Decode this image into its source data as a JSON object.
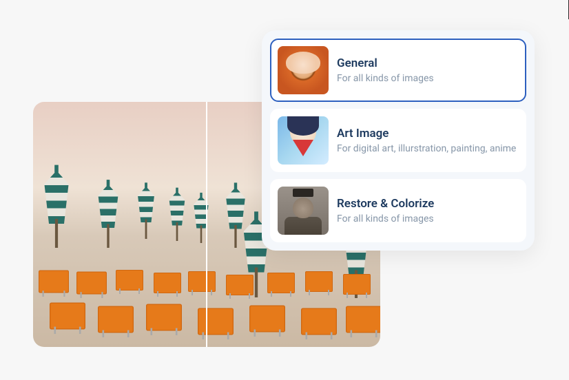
{
  "preview": {
    "alt": "beach-umbrellas-comparison"
  },
  "modes": [
    {
      "id": "general",
      "title": "General",
      "description": "For all kinds of images",
      "selected": true,
      "thumb_icon": "portrait-woman-icon"
    },
    {
      "id": "art-image",
      "title": "Art Image",
      "description": "For digital art, illurstration, painting, anime",
      "selected": false,
      "thumb_icon": "anime-girl-icon"
    },
    {
      "id": "restore-colorize",
      "title": "Restore & Colorize",
      "description": "For all kinds of images",
      "selected": false,
      "thumb_icon": "vintage-portrait-icon"
    }
  ]
}
